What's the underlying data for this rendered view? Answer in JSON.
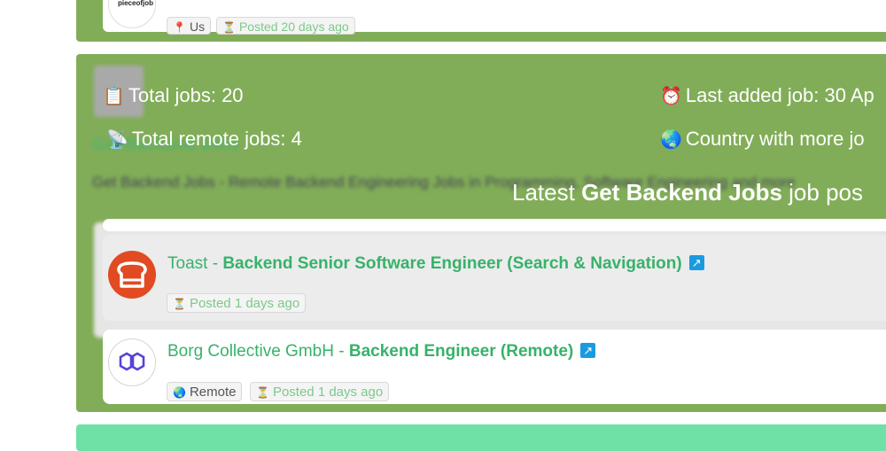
{
  "top_card": {
    "logo_text": "pieceofjob",
    "location": "Us",
    "posted": "Posted 20 days ago"
  },
  "stats": {
    "total_jobs": "Total jobs: 20",
    "total_remote_jobs": "Total remote jobs: 4",
    "last_added": "Last added job: 30 Ap",
    "country_more": "Country with more jo",
    "icons": {
      "total_jobs": "clipboard-icon",
      "total_remote_jobs": "satellite-icon",
      "last_added": "alarm-clock-icon",
      "country_more": "globe-icon"
    }
  },
  "blurred_header": {
    "title": "Get Backend Jobs",
    "description": "Get Backend Jobs - Remote Backend Engineering Jobs in Programming, Software Engineering and more"
  },
  "latest": {
    "prefix": "Latest ",
    "bold": "Get Backend Jobs",
    "suffix": " job pos"
  },
  "jobs": [
    {
      "company": "Toast",
      "separator": " - ",
      "title": "Backend Senior Software Engineer (Search & Navigation)",
      "posted": "Posted 1 days ago",
      "logo": "toast-logo"
    },
    {
      "company": "Borg Collective GmbH",
      "separator": " - ",
      "title": "Backend Engineer (Remote)",
      "location": "Remote",
      "posted": "Posted 1 days ago",
      "logo": "borg-logo"
    }
  ],
  "colors": {
    "card_green": "#81ad58",
    "link_green": "#37b26a",
    "posted_green": "#7cc98a",
    "external_blue": "#1a9be0",
    "next_card": "#6fe0a6"
  }
}
